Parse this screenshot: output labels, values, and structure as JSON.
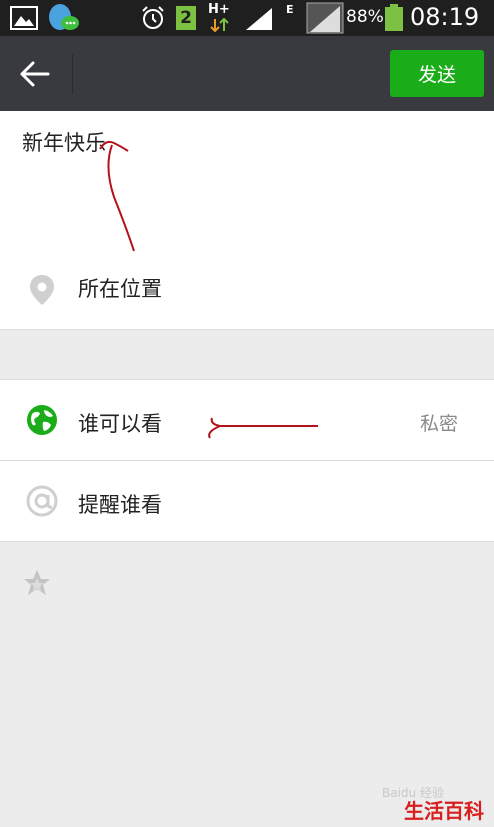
{
  "status_bar": {
    "sim_badge": "2",
    "network_type": "H+",
    "network_type_2": "E",
    "battery": "88%",
    "time": "08:19"
  },
  "app_bar": {
    "send_label": "发送"
  },
  "compose": {
    "text": "新年快乐"
  },
  "location": {
    "label": "所在位置"
  },
  "visibility": {
    "label": "谁可以看",
    "value": "私密"
  },
  "mention": {
    "label": "提醒谁看"
  },
  "footer": {
    "watermark": "Baidu 经验",
    "brand": "生活百科"
  },
  "colors": {
    "accent_green": "#1aad19",
    "app_bar": "#393a3f",
    "annotation_red": "#b3121b"
  }
}
